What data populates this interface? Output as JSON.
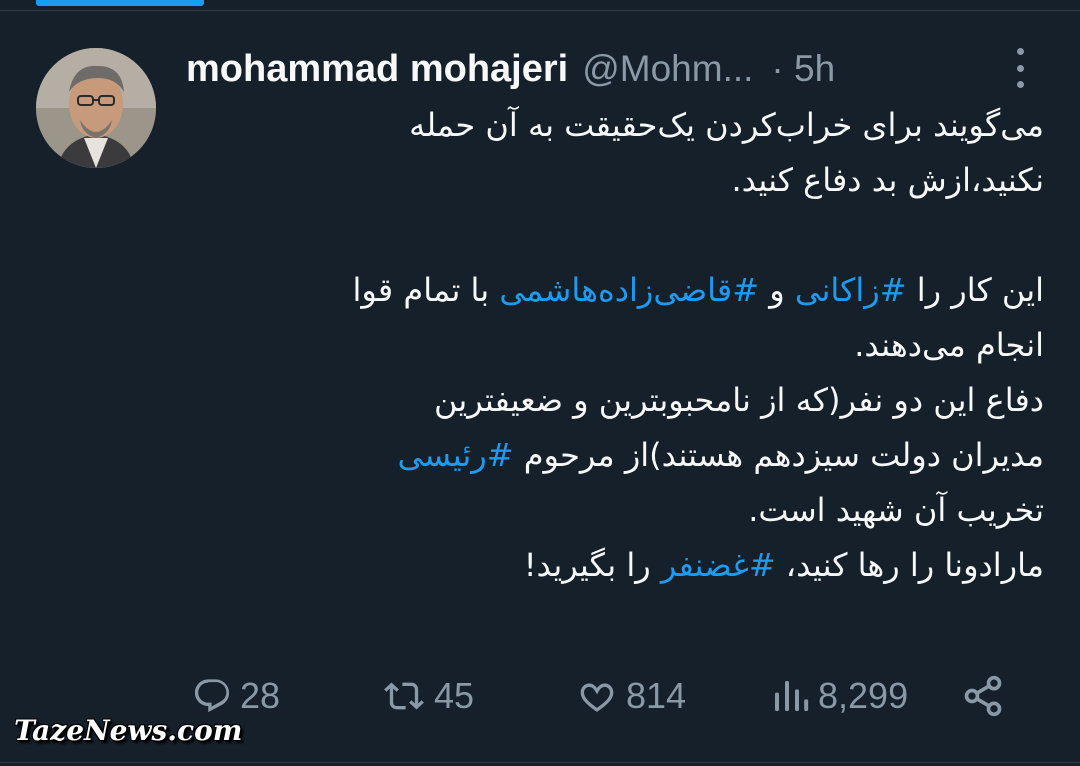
{
  "tweet": {
    "display_name": "mohammad mohajeri",
    "handle": "@Mohm...",
    "time": "· 5h",
    "text": {
      "p1_line1": "می‌گویند برای خراب‌کردن یک‌حقیقت به آن حمله",
      "p1_line2": "نکنید،ازش بد دفاع کنید.",
      "p2_pre": "این کار را ",
      "hashtag_zakani": "#زاکانی",
      "p2_mid": " و  ",
      "hashtag_ghazizadeh": "#قاضی‌زاده‌هاشمی",
      "p2_post": " با تمام قوا",
      "p2_line2": "انجام می‌دهند.",
      "p3_line1": "دفاع این دو نفر(که از نامحبوبترین و ضعیفترین",
      "p3_line2_pre": "مدیران دولت سیزدهم هستند)از مرحوم ",
      "hashtag_raisi": "#رئیسی",
      "p3_line3": "تخریب آن شهید است.",
      "p4_pre": "مارادونا را رها کنید، ",
      "hashtag_ghazanfar": "#غضنفر",
      "p4_post": " را بگیرید!"
    }
  },
  "actions": {
    "replies": "28",
    "retweets": "45",
    "likes": "814",
    "views": "8,299"
  },
  "icons": {
    "more": "more-vertical-icon",
    "reply": "reply-icon",
    "retweet": "retweet-icon",
    "like": "heart-icon",
    "views": "views-icon",
    "share": "share-icon"
  },
  "watermark": "TazeNews.com",
  "colors": {
    "background": "#15202b",
    "text": "#f7f9f9",
    "muted": "#8b98a5",
    "accent": "#1d9bf0"
  }
}
